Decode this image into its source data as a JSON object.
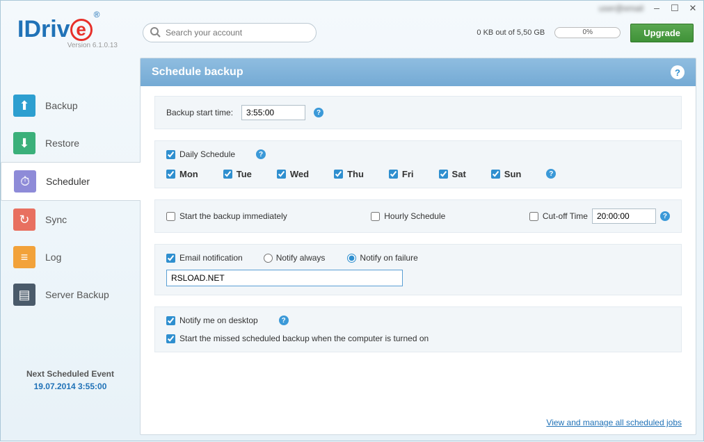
{
  "titlebar": {
    "account": "user@email"
  },
  "logo": {
    "version": "Version  6.1.0.13"
  },
  "search": {
    "placeholder": "Search your account"
  },
  "storage": {
    "text": "0 KB out of 5,50 GB",
    "percent": "0%"
  },
  "upgrade": {
    "label": "Upgrade"
  },
  "sidebar": {
    "items": [
      {
        "label": "Backup"
      },
      {
        "label": "Restore"
      },
      {
        "label": "Scheduler"
      },
      {
        "label": "Sync"
      },
      {
        "label": "Log"
      },
      {
        "label": "Server Backup"
      }
    ],
    "next_event_label": "Next Scheduled Event",
    "next_event_value": "19.07.2014 3:55:00"
  },
  "content": {
    "title": "Schedule  backup",
    "start_time_label": "Backup start time:",
    "start_time_value": "3:55:00",
    "daily_schedule": "Daily Schedule",
    "days": {
      "mon": "Mon",
      "tue": "Tue",
      "wed": "Wed",
      "thu": "Thu",
      "fri": "Fri",
      "sat": "Sat",
      "sun": "Sun"
    },
    "start_immediately": "Start the backup immediately",
    "hourly_schedule": "Hourly Schedule",
    "cutoff_time": "Cut-off Time",
    "cutoff_value": "20:00:00",
    "email_notification": "Email notification",
    "notify_always": "Notify always",
    "notify_failure": "Notify on failure",
    "email_value": "RSLOAD.NET",
    "notify_desktop": "Notify me on desktop",
    "start_missed": "Start the missed scheduled backup when the computer is turned on",
    "footer_link": "View and manage all scheduled jobs"
  }
}
